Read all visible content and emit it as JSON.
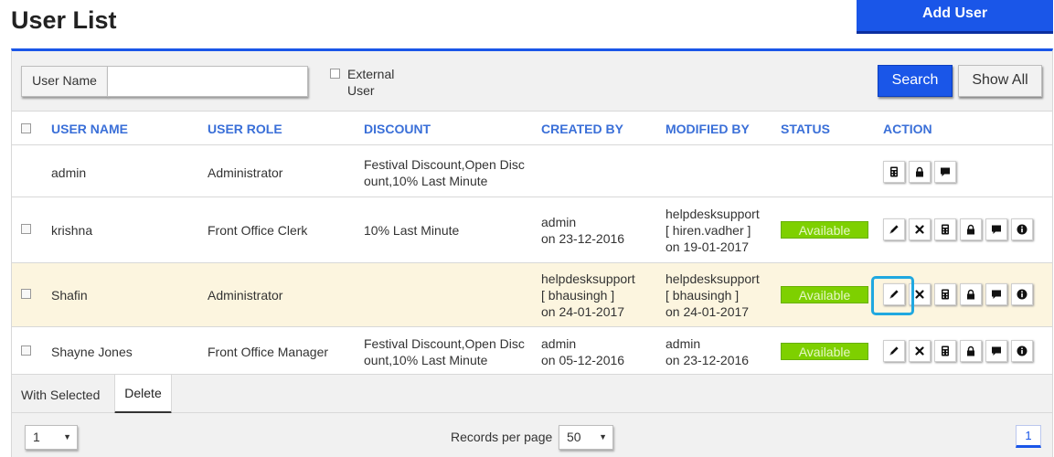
{
  "header": {
    "title": "User List",
    "add_user_label": "Add User"
  },
  "filter": {
    "username_label": "User Name",
    "username_value": "",
    "external_user_label": "External User",
    "search_label": "Search",
    "show_all_label": "Show All"
  },
  "columns": [
    "USER NAME",
    "USER ROLE",
    "DISCOUNT",
    "CREATED BY",
    "MODIFIED BY",
    "STATUS",
    "ACTION"
  ],
  "rows": [
    {
      "user_name": "admin",
      "user_role": "Administrator",
      "discount": [
        "Festival Discount,Open Disc",
        "ount,10% Last Minute"
      ],
      "created_by": [],
      "modified_by": [],
      "status": "",
      "actions": [
        "calculator-icon",
        "lock-icon",
        "comment-icon"
      ]
    },
    {
      "user_name": "krishna",
      "user_role": "Front Office Clerk",
      "discount": [
        "10% Last Minute"
      ],
      "created_by": [
        "admin",
        "on 23-12-2016"
      ],
      "modified_by": [
        "helpdesksupport",
        "[ hiren.vadher ]",
        "on 19-01-2017"
      ],
      "status": "Available",
      "actions": [
        "pencil-icon",
        "delete-icon",
        "calculator-icon",
        "lock-icon",
        "comment-icon",
        "info-icon"
      ]
    },
    {
      "user_name": "Shafin",
      "user_role": "Administrator",
      "discount": [],
      "created_by": [
        "helpdesksupport",
        "[ bhausingh ]",
        "on 24-01-2017"
      ],
      "modified_by": [
        "helpdesksupport",
        "[ bhausingh ]",
        "on 24-01-2017"
      ],
      "status": "Available",
      "actions": [
        "pencil-icon",
        "delete-icon",
        "calculator-icon",
        "lock-icon",
        "comment-icon",
        "info-icon"
      ]
    },
    {
      "user_name": "Shayne Jones",
      "user_role": "Front Office Manager",
      "discount": [
        "Festival Discount,Open Disc",
        "ount,10% Last Minute"
      ],
      "created_by": [
        "admin",
        "on 05-12-2016"
      ],
      "modified_by": [
        "admin",
        "on 23-12-2016"
      ],
      "status": "Available",
      "actions": [
        "pencil-icon",
        "delete-icon",
        "calculator-icon",
        "lock-icon",
        "comment-icon",
        "info-icon"
      ]
    }
  ],
  "bulk": {
    "with_selected_label": "With Selected",
    "delete_label": "Delete"
  },
  "pagination": {
    "page_select_value": "1",
    "records_per_page_label": "Records per page",
    "records_per_page_value": "50",
    "current_page": "1"
  },
  "colors": {
    "accent": "#1a56e8",
    "status_available": "#7ed000",
    "highlight_row": "#fcf5df",
    "focus_ring": "#20a8e0"
  }
}
